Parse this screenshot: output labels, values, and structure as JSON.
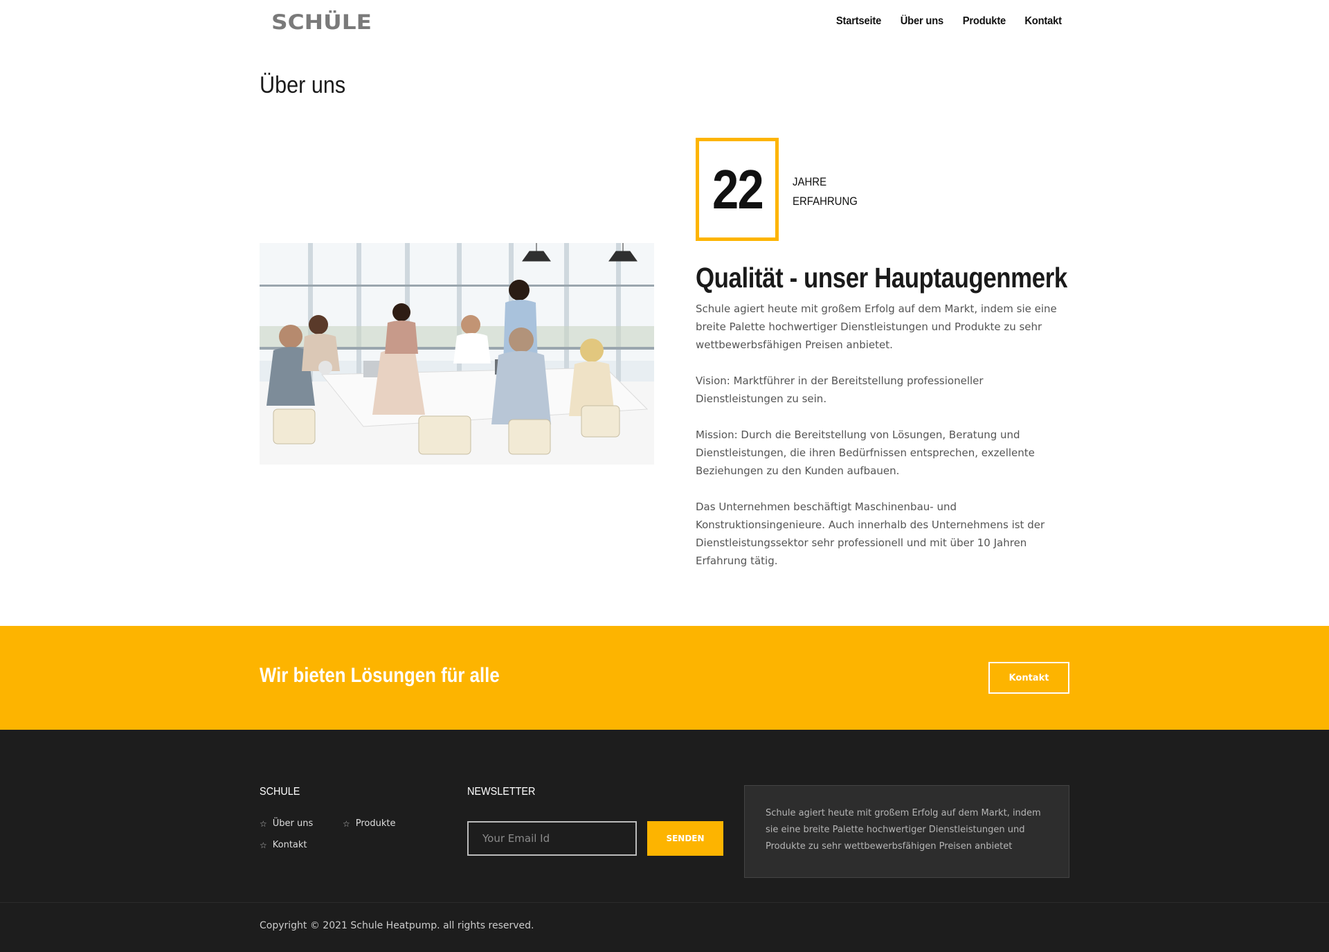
{
  "brand": {
    "logo_text": "SCHÜLE",
    "accent_color": "#fdb400",
    "dark_color": "#1d1d1d"
  },
  "nav": {
    "items": [
      "Startseite",
      "Über uns",
      "Produkte",
      "Kontakt"
    ]
  },
  "page": {
    "title": "Über uns"
  },
  "experience": {
    "number": "22",
    "label_line1": "JAHRE",
    "label_line2": "ERFAHRUNG"
  },
  "about": {
    "heading": "Qualität - unser Hauptaugenmerk",
    "paragraphs": [
      "Schule agiert heute mit großem Erfolg auf dem Markt, indem sie eine breite Palette hochwertiger Dienstleistungen und Produkte zu sehr wettbewerbsfähigen Preisen anbietet.",
      "Vision: Marktführer in der Bereitstellung professioneller Dienstleistungen zu sein.",
      "Mission: Durch die Bereitstellung von Lösungen, Beratung und Dienstleistungen, die ihren Bedürfnissen entsprechen, exzellente Beziehungen zu den Kunden aufbauen.",
      "Das Unternehmen beschäftigt Maschinenbau- und Konstruktionsingenieure. Auch innerhalb des Unternehmens ist der Dienstleistungssektor sehr professionell und mit über 10 Jahren Erfahrung tätig."
    ]
  },
  "cta": {
    "title": "Wir bieten Lösungen für alle",
    "button": "Kontakt"
  },
  "footer": {
    "col1_title": "SCHULE",
    "links": [
      "Über uns",
      "Produkte",
      "Kontakt"
    ],
    "col2_title": "NEWSLETTER",
    "newsletter_placeholder": "Your Email Id",
    "newsletter_button": "SENDEN",
    "about_text": "Schule agiert heute mit großem Erfolg auf dem Markt, indem sie eine breite Palette hochwertiger Dienstleistungen und Produkte zu sehr wettbewerbsfähigen Preisen anbietet",
    "copyright": "Copyright © 2021 Schule Heatpump. all rights reserved."
  }
}
